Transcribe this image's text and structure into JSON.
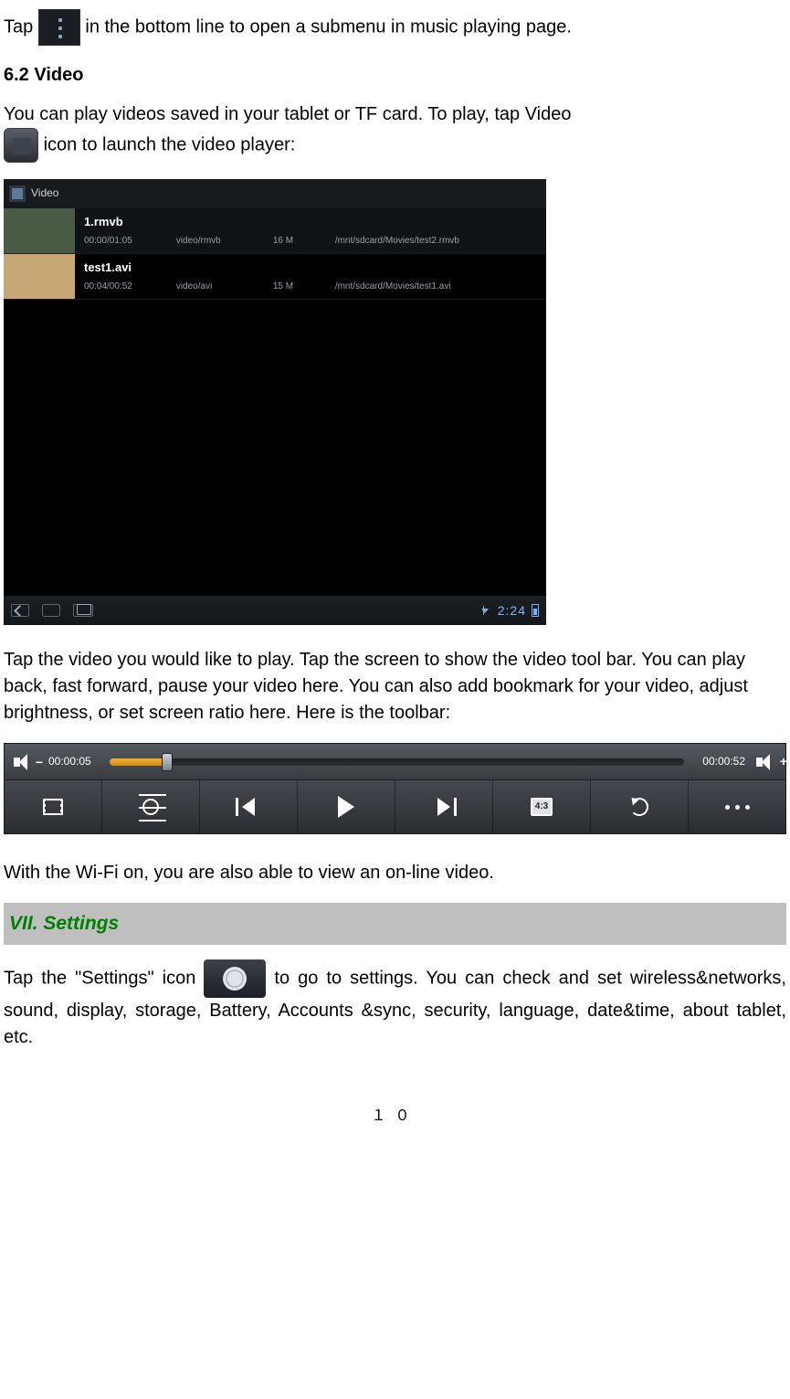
{
  "para_tap_submenu_pre": "Tap ",
  "para_tap_submenu_post": " in the bottom line to open a submenu in music playing page.",
  "section_video_heading": "6.2 Video",
  "para_video_intro_pre": "You can play videos saved in your tablet or TF card. To play, tap Video ",
  "para_video_intro_post": "icon to launch the video player:",
  "video_list": {
    "title": "Video",
    "items": [
      {
        "name": "1.rmvb",
        "duration": "00:00/01:05",
        "mime": "video/rmvb",
        "size": "16 M",
        "path": "/mnt/sdcard/Movies/test2.rmvb"
      },
      {
        "name": "test1.avi",
        "duration": "00:04/00:52",
        "mime": "video/avi",
        "size": "15 M",
        "path": "/mnt/sdcard/Movies/test1.avi"
      }
    ],
    "status_time": "2:24"
  },
  "para_tap_video": "Tap the video you would like to play. Tap the screen to show the video tool bar. You can play back, fast forward, pause your video here. You can also add bookmark for your video, adjust brightness, or set screen ratio here. Here is the toolbar:",
  "toolbar": {
    "elapsed": "00:00:05",
    "total": "00:00:52",
    "ratio_label": "4:3"
  },
  "para_wifi_online": "With the Wi-Fi on, you are also able to view an on-line video.",
  "section_settings_heading": "VII. Settings",
  "para_settings_pre": "Tap the \"Settings\" icon ",
  "para_settings_post": " to go to settings. You can check and set wireless&networks, sound, display, storage, Battery, Accounts &sync, security, language, date&time, about tablet, etc.",
  "page_number": "１０"
}
